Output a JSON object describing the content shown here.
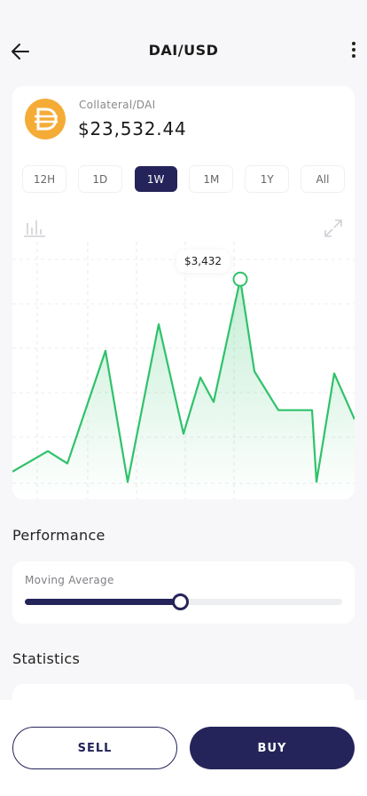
{
  "header": {
    "title": "DAI/USD"
  },
  "asset": {
    "label": "Collateral/DAI",
    "value": "$23,532.44"
  },
  "periods": [
    {
      "label": "12H"
    },
    {
      "label": "1D"
    },
    {
      "label": "1W",
      "active": true
    },
    {
      "label": "1M"
    },
    {
      "label": "1Y"
    },
    {
      "label": "All"
    }
  ],
  "tooltip": {
    "value": "$3,432"
  },
  "performance": {
    "title": "Performance",
    "moving_average_label": "Moving Average",
    "moving_average_percent": 49
  },
  "statistics": {
    "title": "Statistics"
  },
  "buttons": {
    "sell": "SELL",
    "buy": "BUY"
  },
  "colors": {
    "accent": "#25245a",
    "line": "#2fc26a",
    "coin": "#f5ac37"
  },
  "chart_data": {
    "type": "line",
    "values": [
      14,
      34,
      22,
      132,
      4,
      158,
      51,
      106,
      82,
      202,
      112,
      74,
      74,
      4,
      110,
      65
    ],
    "highlight_index": 9,
    "grid": true
  }
}
